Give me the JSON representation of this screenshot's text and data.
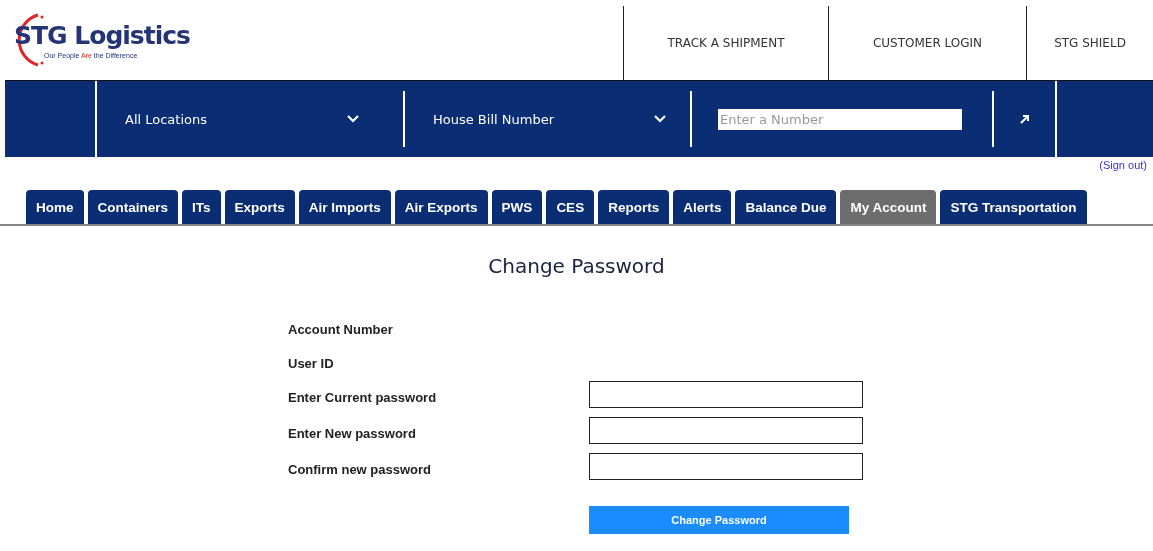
{
  "logo": {
    "name": "STG Logistics",
    "tagline": {
      "before": "Our People",
      "accent": "Are",
      "after": "the Difference"
    }
  },
  "top_nav": [
    "TRACK A SHIPMENT",
    "CUSTOMER LOGIN",
    "STG SHIELD"
  ],
  "search_bar": {
    "location": "All Locations",
    "number_type": "House Bill Number",
    "placeholder": "Enter a Number"
  },
  "sign_out": "(Sign out)",
  "tabs": [
    {
      "label": "Home",
      "selected": false
    },
    {
      "label": "Containers",
      "selected": false
    },
    {
      "label": "ITs",
      "selected": false
    },
    {
      "label": "Exports",
      "selected": false
    },
    {
      "label": "Air Imports",
      "selected": false
    },
    {
      "label": "Air Exports",
      "selected": false
    },
    {
      "label": "PWS",
      "selected": false
    },
    {
      "label": "CES",
      "selected": false
    },
    {
      "label": "Reports",
      "selected": false
    },
    {
      "label": "Alerts",
      "selected": false
    },
    {
      "label": "Balance Due",
      "selected": false
    },
    {
      "label": "My Account",
      "selected": true
    },
    {
      "label": "STG Transportation",
      "selected": false
    }
  ],
  "page_title": "Change Password",
  "form": [
    {
      "label": "Account Number",
      "kind": "info"
    },
    {
      "label": "User ID",
      "kind": "info"
    },
    {
      "label": "Enter Current password",
      "kind": "password"
    },
    {
      "label": "Enter New password",
      "kind": "password"
    },
    {
      "label": "Confirm new password",
      "kind": "password"
    }
  ],
  "submit_button": "Change Password"
}
